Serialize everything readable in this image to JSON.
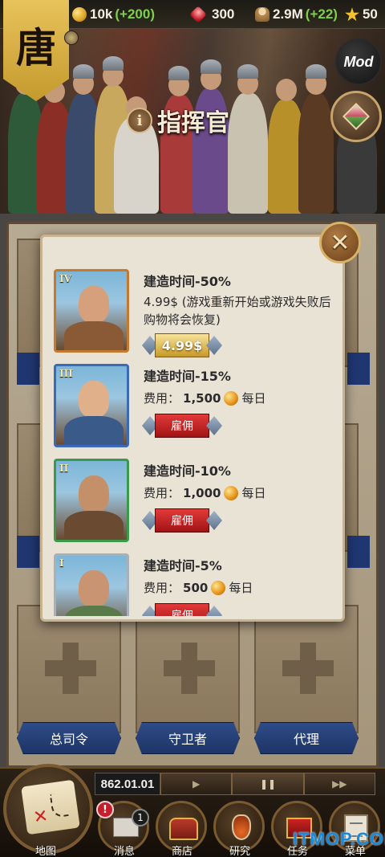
{
  "resources": {
    "gold": "10k",
    "gold_delta": "(+200)",
    "gems": "300",
    "population": "2.9M",
    "population_delta": "(+22)",
    "stars": "50"
  },
  "dynasty": {
    "char": "唐"
  },
  "mod_label": "Mod",
  "page_title": "指挥官",
  "roles": [
    "总司令",
    "守卫者",
    "代理"
  ],
  "modal": {
    "close_glyph": "✕",
    "cards": [
      {
        "rank": "IV",
        "title": "建造时间-50%",
        "desc": "4.99$ (游戏重新开始或游戏失败后购物将会恢复)",
        "button": "4.99$"
      },
      {
        "rank": "III",
        "title": "建造时间-15%",
        "cost_label": "费用：",
        "cost": "1,500",
        "period": "每日",
        "button": "雇佣"
      },
      {
        "rank": "II",
        "title": "建造时间-10%",
        "cost_label": "费用：",
        "cost": "1,000",
        "period": "每日",
        "button": "雇佣"
      },
      {
        "rank": "I",
        "title": "建造时间-5%",
        "cost_label": "费用：",
        "cost": "500",
        "period": "每日",
        "button": "雇佣"
      }
    ]
  },
  "bottom": {
    "date": "862.01.01",
    "speed": [
      "▶",
      "❚❚",
      "▶▶"
    ],
    "nav": [
      "地图",
      "消息",
      "商店",
      "研究",
      "任务",
      "菜单"
    ],
    "message_alert": "!",
    "message_count": "1"
  },
  "watermark": "ITMOP.COM",
  "colors": {
    "accent_gold": "#d79a13",
    "role_blue": "#2f4c88",
    "hire_red": "#c51f2e",
    "positive_green": "#7cd04a"
  },
  "icons": [
    "coin-icon",
    "gem-icon",
    "population-icon",
    "star-icon",
    "compass-icon",
    "info-icon",
    "gem-button-icon",
    "close-icon",
    "map-scroll-icon",
    "envelope-icon",
    "chest-icon",
    "flask-icon",
    "book-icon",
    "list-icon"
  ]
}
